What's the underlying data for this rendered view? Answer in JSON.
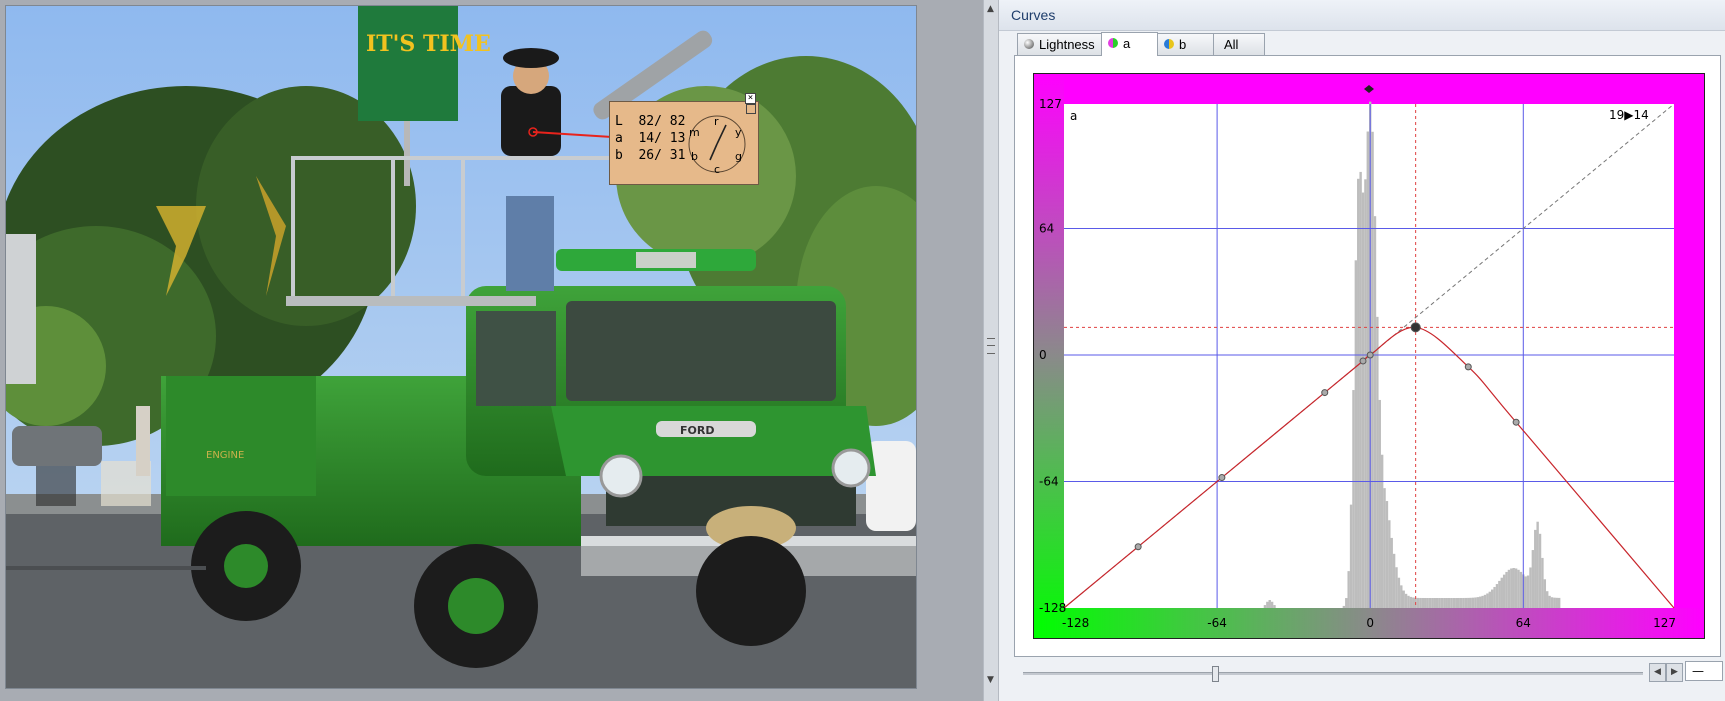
{
  "panel_title": "Curves",
  "tabs": [
    {
      "label": "Lightness",
      "icon": "lightness-dot-icon"
    },
    {
      "label": "a",
      "icon": "a-channel-dot-icon"
    },
    {
      "label": "b",
      "icon": "b-channel-dot-icon"
    },
    {
      "label": "All",
      "icon": ""
    }
  ],
  "active_tab": "a",
  "curve": {
    "channel_label": "a",
    "point_readout": "19▶14",
    "y_ticks": [
      "127",
      "64",
      "0",
      "-64",
      "-128"
    ],
    "x_ticks": [
      "-128",
      "-64",
      "0",
      "64",
      "127"
    ],
    "x_range": [
      -128,
      127
    ],
    "y_range": [
      -128,
      127
    ],
    "selected_point": {
      "x": 19,
      "y": 14
    },
    "curve_points": [
      [
        -128,
        -128
      ],
      [
        -97,
        -97
      ],
      [
        -62,
        -62
      ],
      [
        -19,
        -19
      ],
      [
        -3,
        -3
      ],
      [
        0,
        0
      ],
      [
        19,
        14
      ],
      [
        41,
        -6
      ],
      [
        61,
        -34
      ],
      [
        127,
        -128
      ]
    ],
    "colors": {
      "magenta": "#ff00ff",
      "green": "#00ff00",
      "curve": "#c8262c",
      "grid": "#5a5ae8"
    }
  },
  "lab_readout": {
    "rows": [
      {
        "channel": "L",
        "before": "82",
        "after": "82"
      },
      {
        "channel": "a",
        "before": "14",
        "after": "13"
      },
      {
        "channel": "b",
        "before": "26",
        "after": "31"
      }
    ],
    "wheel_letters": [
      "r",
      "y",
      "g",
      "c",
      "b",
      "m"
    ]
  },
  "photo": {
    "banner_text": "IT'S TIME",
    "grille_badge": "FORD",
    "door_text": "ENGINE"
  },
  "scrollbar": {
    "position": 0.31
  },
  "field_value": "—"
}
